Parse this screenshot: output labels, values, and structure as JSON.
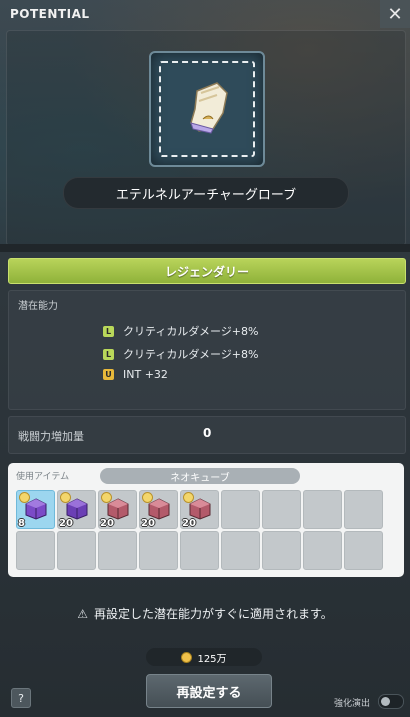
{
  "window": {
    "title": "POTENTIAL",
    "close_icon": "close-icon"
  },
  "item": {
    "name": "エテルネルアーチャーグローブ",
    "icon": "glove-icon"
  },
  "grade": {
    "label": "レジェンダリー",
    "color": "#a6c94a"
  },
  "potential": {
    "section_label": "潜在能力",
    "lines": [
      {
        "badge": "L",
        "text": "クリティカルダメージ+8%"
      },
      {
        "badge": "L",
        "text": "クリティカルダメージ+8%"
      },
      {
        "badge": "U",
        "text": "INT +32"
      }
    ]
  },
  "combat_power": {
    "label": "戦闘力増加量",
    "value": "0"
  },
  "use_items": {
    "label": "使用アイテム",
    "selected_cube": "ネオキューブ",
    "slots": [
      {
        "qty": "8",
        "cube": "purple-cube-icon",
        "selected": true
      },
      {
        "qty": "20",
        "cube": "purple-cube-icon",
        "selected": false
      },
      {
        "qty": "20",
        "cube": "red-cube-icon",
        "selected": false
      },
      {
        "qty": "20",
        "cube": "red-cube-icon",
        "selected": false
      },
      {
        "qty": "20",
        "cube": "red-cube-icon",
        "selected": false
      }
    ]
  },
  "notice": "再設定した潜在能力がすぐに適用されます。",
  "cost": {
    "amount": "125万"
  },
  "actions": {
    "reset_label": "再設定する",
    "help_label": "?"
  },
  "effects_toggle": {
    "label": "強化演出",
    "enabled": false
  }
}
